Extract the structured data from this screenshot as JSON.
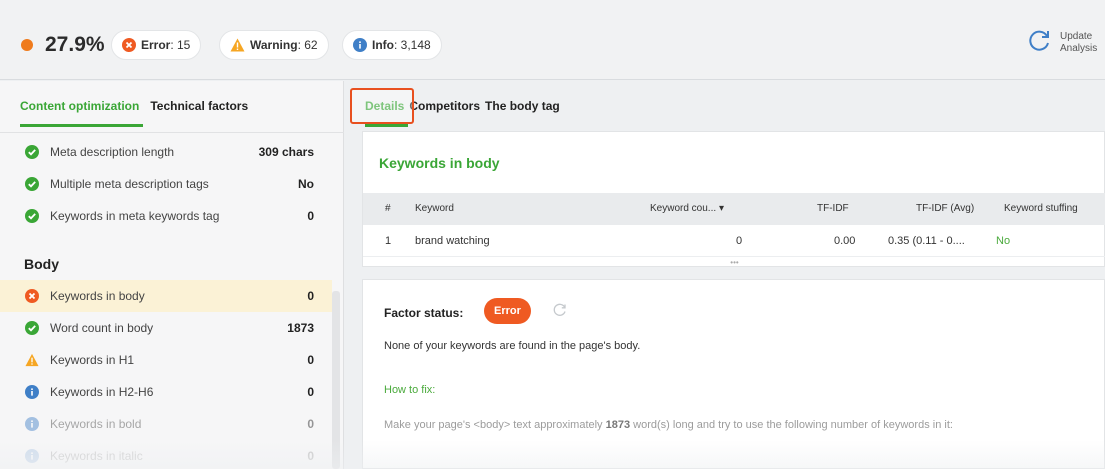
{
  "header": {
    "score": "27.9%",
    "score_color": "#ef7b1c",
    "error_label": "Error",
    "error_count": ": 15",
    "warning_label": "Warning",
    "warning_count": ": 62",
    "info_label": "Info",
    "info_count": ": 3,148",
    "update_line1": "Update",
    "update_line2": "Analysis"
  },
  "left_tabs": [
    "Content optimization",
    "Technical factors"
  ],
  "meta_rows": [
    {
      "label": "Meta description length",
      "value": "309 chars",
      "status": "ok"
    },
    {
      "label": "Multiple meta description tags",
      "value": "No",
      "status": "ok"
    },
    {
      "label": "Keywords in meta keywords tag",
      "value": "0",
      "status": "ok"
    }
  ],
  "body_section": "Body",
  "body_rows": [
    {
      "label": "Keywords in body",
      "value": "0",
      "status": "error"
    },
    {
      "label": "Word count in body",
      "value": "1873",
      "status": "ok"
    },
    {
      "label": "Keywords in H1",
      "value": "0",
      "status": "warning"
    },
    {
      "label": "Keywords in H2-H6",
      "value": "0",
      "status": "info"
    },
    {
      "label": "Keywords in bold",
      "value": "0",
      "status": "info"
    },
    {
      "label": "Keywords in italic",
      "value": "0",
      "status": "info"
    }
  ],
  "right_tabs": [
    "Details",
    "Competitors",
    "The body tag"
  ],
  "keywords_card": {
    "title": "Keywords in body",
    "columns": [
      "#",
      "Keyword",
      "Keyword cou...",
      "TF-IDF",
      "TF-IDF (Avg)",
      "Keyword stuffing"
    ],
    "rows": [
      {
        "num": "1",
        "keyword": "brand watching",
        "count": "0",
        "tfidf": "0.00",
        "tfidf_avg": "0.35 (0.11 - 0....",
        "stuffing": "No"
      }
    ],
    "grip": "•••"
  },
  "factor": {
    "label": "Factor status:",
    "status": "Error",
    "message": "None of your keywords are found in the page's body.",
    "how_to_fix": "How to fix:",
    "fix_before": "Make your page's <body> text approximately ",
    "fix_bold": "1873",
    "fix_after": " word(s) long and try to use the following number of keywords in it:"
  },
  "colors": {
    "green": "#3aa636",
    "error": "#ef5a22",
    "warning": "#f6a623",
    "info": "#3f7fc7",
    "highlight_box": "#e8501f"
  }
}
